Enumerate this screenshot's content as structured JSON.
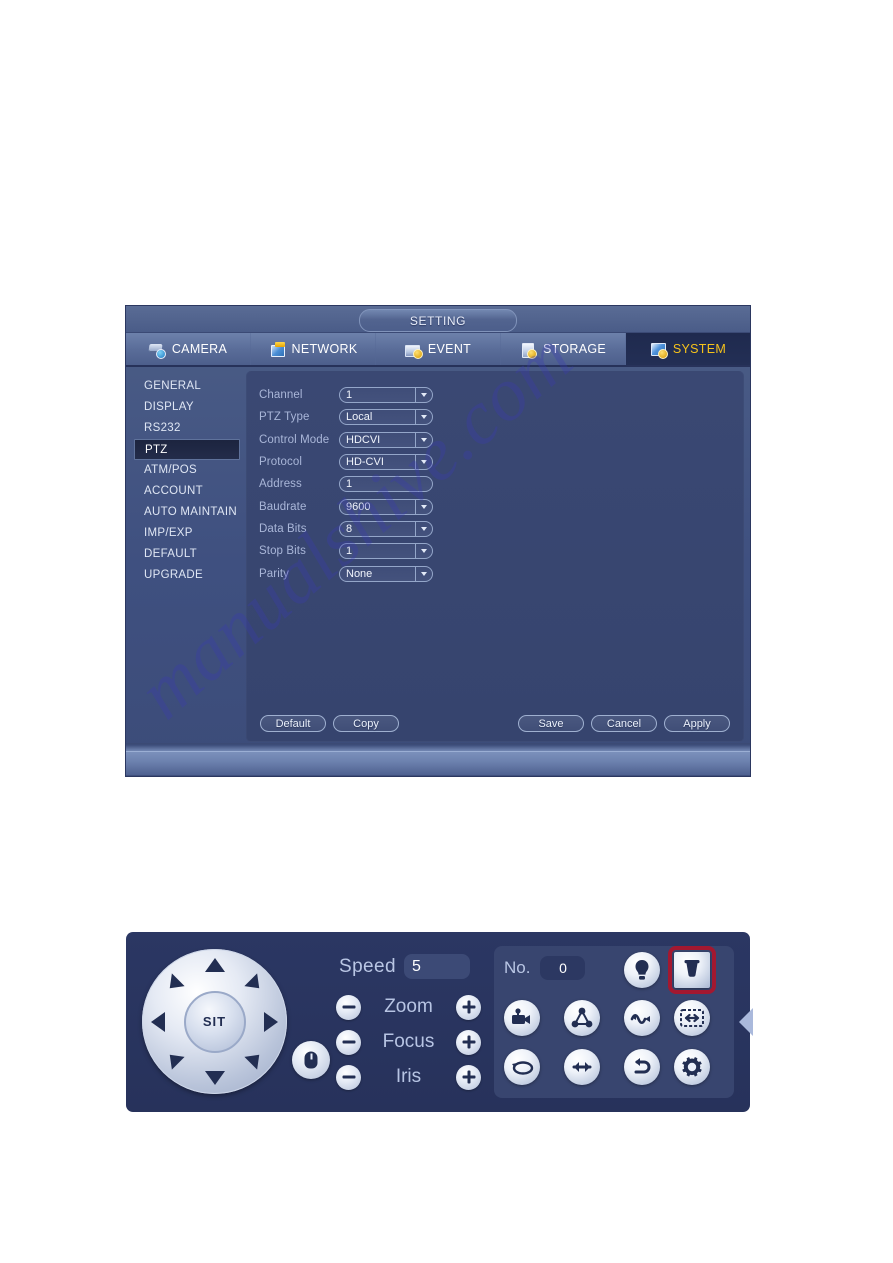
{
  "watermark": {
    "text": "manualshive.com"
  },
  "setting_window": {
    "title": "SETTING",
    "tabs": [
      {
        "label": "CAMERA",
        "icon": "camera-icon",
        "active": false
      },
      {
        "label": "NETWORK",
        "icon": "network-icon",
        "active": false
      },
      {
        "label": "EVENT",
        "icon": "event-icon",
        "active": false
      },
      {
        "label": "STORAGE",
        "icon": "storage-icon",
        "active": false
      },
      {
        "label": "SYSTEM",
        "icon": "system-icon",
        "active": true
      }
    ],
    "sidebar": {
      "items": [
        {
          "label": "GENERAL",
          "active": false
        },
        {
          "label": "DISPLAY",
          "active": false
        },
        {
          "label": "RS232",
          "active": false
        },
        {
          "label": "PTZ",
          "active": true
        },
        {
          "label": "ATM/POS",
          "active": false
        },
        {
          "label": "ACCOUNT",
          "active": false
        },
        {
          "label": "AUTO MAINTAIN",
          "active": false
        },
        {
          "label": "IMP/EXP",
          "active": false
        },
        {
          "label": "DEFAULT",
          "active": false
        },
        {
          "label": "UPGRADE",
          "active": false
        }
      ]
    },
    "form": {
      "rows": [
        {
          "label": "Channel",
          "value": "1",
          "dropdown": true
        },
        {
          "label": "PTZ Type",
          "value": "Local",
          "dropdown": true
        },
        {
          "label": "Control Mode",
          "value": "HDCVI",
          "dropdown": true
        },
        {
          "label": "Protocol",
          "value": "HD-CVI",
          "dropdown": true
        },
        {
          "label": "Address",
          "value": "1",
          "dropdown": false
        },
        {
          "label": "Baudrate",
          "value": "9600",
          "dropdown": true
        },
        {
          "label": "Data Bits",
          "value": "8",
          "dropdown": true
        },
        {
          "label": "Stop Bits",
          "value": "1",
          "dropdown": true
        },
        {
          "label": "Parity",
          "value": "None",
          "dropdown": true
        }
      ]
    },
    "buttons": {
      "left": [
        {
          "label": "Default"
        },
        {
          "label": "Copy"
        }
      ],
      "right": [
        {
          "label": "Save"
        },
        {
          "label": "Cancel"
        },
        {
          "label": "Apply"
        }
      ]
    }
  },
  "ptz_panel": {
    "dpad": {
      "center_label": "SIT",
      "directions": [
        "up",
        "up-right",
        "right",
        "down-right",
        "down",
        "down-left",
        "left",
        "up-left"
      ]
    },
    "mouse_button": {
      "icon": "mouse-icon"
    },
    "speed": {
      "label": "Speed",
      "value": "5"
    },
    "controls": [
      {
        "label": "Zoom",
        "minus": "minus-icon",
        "plus": "plus-icon"
      },
      {
        "label": "Focus",
        "minus": "minus-icon",
        "plus": "plus-icon"
      },
      {
        "label": "Iris",
        "minus": "minus-icon",
        "plus": "plus-icon"
      }
    ],
    "preset": {
      "label": "No.",
      "value": "0"
    },
    "function_buttons": [
      {
        "name": "light-icon",
        "row": 0,
        "col": 2,
        "highlighted": false
      },
      {
        "name": "wiper-icon",
        "row": 0,
        "col": 3,
        "highlighted": true
      },
      {
        "name": "preset-icon",
        "row": 1,
        "col": 0,
        "highlighted": false
      },
      {
        "name": "tour-icon",
        "row": 1,
        "col": 1,
        "highlighted": false
      },
      {
        "name": "pattern-icon",
        "row": 1,
        "col": 2,
        "highlighted": false
      },
      {
        "name": "autoscan-icon",
        "row": 1,
        "col": 3,
        "highlighted": false
      },
      {
        "name": "rotate-icon",
        "row": 2,
        "col": 0,
        "highlighted": false
      },
      {
        "name": "panwidth-icon",
        "row": 2,
        "col": 1,
        "highlighted": false
      },
      {
        "name": "autopan-icon",
        "row": 2,
        "col": 2,
        "highlighted": false
      },
      {
        "name": "settings-icon",
        "row": 2,
        "col": 3,
        "highlighted": false
      }
    ],
    "collapse_arrow": {
      "icon": "chevron-left-icon"
    },
    "highlight_color": "#a31830"
  }
}
